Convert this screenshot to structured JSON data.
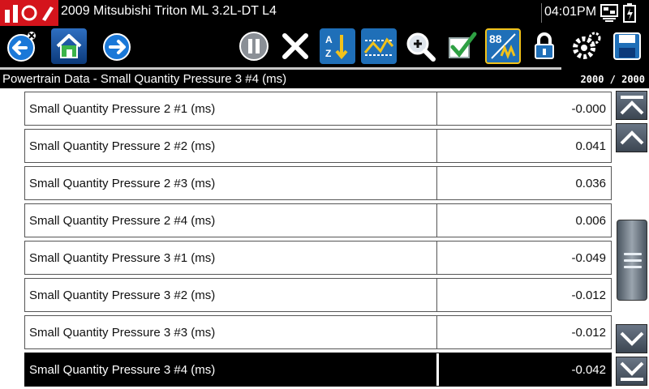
{
  "titlebar": {
    "vehicle": "2009 Mitsubishi Triton ML 3.2L-DT L4",
    "time": "04:01PM"
  },
  "toolbar": [
    {
      "name": "back-button",
      "icon": "back-arrow-icon"
    },
    {
      "name": "home-button",
      "icon": "home-icon"
    },
    {
      "name": "forward-button",
      "icon": "forward-arrow-icon"
    },
    {
      "name": "pause-button",
      "icon": "pause-icon"
    },
    {
      "name": "clear-button",
      "icon": "close-icon"
    },
    {
      "name": "sort-button",
      "icon": "sort-icon"
    },
    {
      "name": "graph-button",
      "icon": "graph-icon"
    },
    {
      "name": "zoom-button",
      "icon": "zoom-icon"
    },
    {
      "name": "select-button",
      "icon": "checkmark-icon"
    },
    {
      "name": "units-button",
      "icon": "units-icon"
    },
    {
      "name": "lock-button",
      "icon": "lock-icon"
    },
    {
      "name": "settings-button",
      "icon": "gear-icon"
    },
    {
      "name": "save-button",
      "icon": "save-icon"
    }
  ],
  "header": {
    "title": "Powertrain Data - Small Quantity Pressure 3 #4 (ms)",
    "count": "2000 / 2000",
    "progress": 0.865
  },
  "rows": [
    {
      "label": "Small Quantity Pressure 2 #1 (ms)",
      "value": "-0.000"
    },
    {
      "label": "Small Quantity Pressure 2 #2 (ms)",
      "value": "0.041"
    },
    {
      "label": "Small Quantity Pressure 2 #3 (ms)",
      "value": "0.036"
    },
    {
      "label": "Small Quantity Pressure 2 #4 (ms)",
      "value": "0.006"
    },
    {
      "label": "Small Quantity Pressure 3 #1 (ms)",
      "value": "-0.049"
    },
    {
      "label": "Small Quantity Pressure 3 #2 (ms)",
      "value": "-0.012"
    },
    {
      "label": "Small Quantity Pressure 3 #3 (ms)",
      "value": "-0.012"
    },
    {
      "label": "Small Quantity Pressure 3 #4 (ms)",
      "value": "-0.042"
    }
  ],
  "selected_row": 7,
  "colors": {
    "accent_blue": "#1a78d8",
    "brand_red": "#d4141c",
    "units_yellow": "#f2c21a"
  }
}
